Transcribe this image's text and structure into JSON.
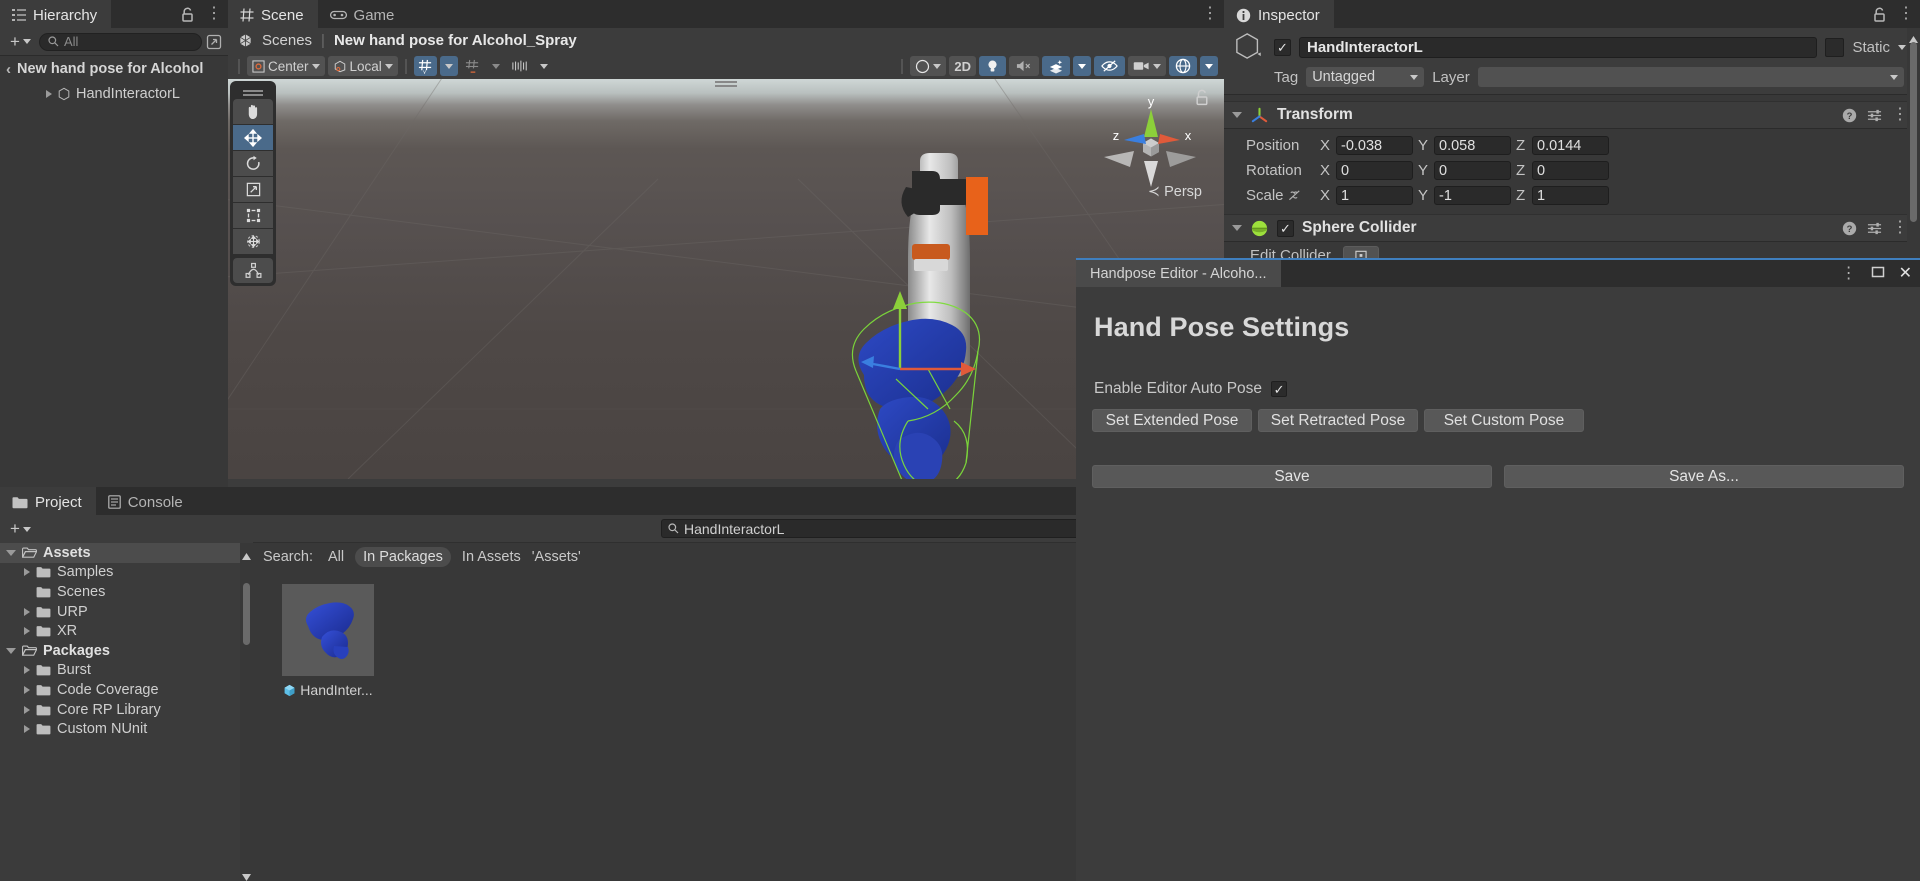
{
  "hierarchy": {
    "tab_label": "Hierarchy",
    "search_placeholder": "All",
    "breadcrumb": "New hand pose for Alcohol",
    "items": [
      {
        "label": "HandInteractorL"
      }
    ]
  },
  "scene": {
    "tabs": [
      {
        "label": "Scene",
        "icon": "grid-icon",
        "active": true
      },
      {
        "label": "Game",
        "icon": "gamepad-icon",
        "active": false
      }
    ],
    "breadcrumb_root": "Scenes",
    "breadcrumb_sep": "|",
    "breadcrumb_title": "New hand pose for Alcohol_Spray",
    "pivot_mode": "Center",
    "pivot_rotation": "Local",
    "toggle_2d": "2D",
    "gizmo_axes": {
      "x": "x",
      "y": "y",
      "z": "z"
    },
    "projection": "Persp",
    "projection_arrow": "≺",
    "tools": [
      {
        "name": "hand-tool",
        "selected": false
      },
      {
        "name": "move-tool",
        "selected": true
      },
      {
        "name": "rotate-tool",
        "selected": false
      },
      {
        "name": "scale-tool",
        "selected": false
      },
      {
        "name": "rect-tool",
        "selected": false
      },
      {
        "name": "transform-tool",
        "selected": false
      },
      {
        "name": "custom-editor-tool",
        "selected": false
      }
    ]
  },
  "inspector": {
    "tab_label": "Inspector",
    "object_name": "HandInteractorL",
    "object_enabled": true,
    "static_label": "Static",
    "static_checked": false,
    "tag_label": "Tag",
    "tag_value": "Untagged",
    "layer_label": "Layer",
    "layer_value": "",
    "components": [
      {
        "title": "Transform",
        "icon": "transform-icon",
        "rows": [
          {
            "label": "Position",
            "x": "-0.038",
            "y": "0.058",
            "z": "0.0144"
          },
          {
            "label": "Rotation",
            "x": "0",
            "y": "0",
            "z": "0"
          },
          {
            "label": "Scale",
            "x": "1",
            "y": "-1",
            "z": "1"
          }
        ],
        "axis_labels": {
          "x": "X",
          "y": "Y",
          "z": "Z"
        }
      },
      {
        "title": "Sphere Collider",
        "icon": "sphere-collider-icon",
        "enabled": true,
        "edit_collider_label": "Edit Collider"
      }
    ]
  },
  "project": {
    "tabs": [
      {
        "label": "Project",
        "icon": "folder-icon",
        "active": true
      },
      {
        "label": "Console",
        "icon": "console-icon",
        "active": false
      }
    ],
    "tree": [
      {
        "label": "Assets",
        "depth": 0,
        "expanded": true,
        "arrow": true,
        "selected": true,
        "bold": true,
        "open_folder": true
      },
      {
        "label": "Samples",
        "depth": 1,
        "expanded": false,
        "arrow": true,
        "selected": false,
        "bold": false,
        "open_folder": false
      },
      {
        "label": "Scenes",
        "depth": 1,
        "expanded": false,
        "arrow": false,
        "selected": false,
        "bold": false,
        "open_folder": false
      },
      {
        "label": "URP",
        "depth": 1,
        "expanded": false,
        "arrow": true,
        "selected": false,
        "bold": false,
        "open_folder": false
      },
      {
        "label": "XR",
        "depth": 1,
        "expanded": false,
        "arrow": true,
        "selected": false,
        "bold": false,
        "open_folder": false
      },
      {
        "label": "Packages",
        "depth": 0,
        "expanded": true,
        "arrow": true,
        "selected": false,
        "bold": true,
        "open_folder": true
      },
      {
        "label": "Burst",
        "depth": 1,
        "expanded": false,
        "arrow": true,
        "selected": false,
        "bold": false,
        "open_folder": false
      },
      {
        "label": "Code Coverage",
        "depth": 1,
        "expanded": false,
        "arrow": true,
        "selected": false,
        "bold": false,
        "open_folder": false
      },
      {
        "label": "Core RP Library",
        "depth": 1,
        "expanded": false,
        "arrow": true,
        "selected": false,
        "bold": false,
        "open_folder": false
      },
      {
        "label": "Custom NUnit",
        "depth": 1,
        "expanded": false,
        "arrow": true,
        "selected": false,
        "bold": false,
        "open_folder": false
      }
    ],
    "search_value": "HandInteractorL",
    "search_clear": "×",
    "filter_label": "Search:",
    "filters": [
      {
        "label": "All",
        "active": false
      },
      {
        "label": "In Packages",
        "active": true
      },
      {
        "label": "In Assets",
        "active": false
      },
      {
        "label": "'Assets'",
        "active": false
      }
    ],
    "assets": [
      {
        "label": "HandInter...",
        "icon": "prefab-icon"
      }
    ]
  },
  "handpose": {
    "window_title": "Handpose Editor - Alcoho...",
    "heading": "Hand Pose Settings",
    "auto_pose_label": "Enable Editor Auto Pose",
    "auto_pose_checked": true,
    "pose_buttons": [
      {
        "label": "Set Extended Pose"
      },
      {
        "label": "Set Retracted Pose"
      },
      {
        "label": "Set Custom Pose"
      }
    ],
    "save_buttons": [
      {
        "label": "Save"
      },
      {
        "label": "Save As..."
      }
    ],
    "controls": {
      "menu": "⋮",
      "maximize": "□",
      "close": "✕"
    }
  },
  "colors": {
    "accent_blue": "#4a6a8a",
    "window_accent": "#3f7fbf",
    "panel_bg": "#383838",
    "tab_bg": "#2d2d2d",
    "axis_x": "#e05a3a",
    "axis_y": "#8ccf3a",
    "axis_z": "#3a7fe0"
  }
}
